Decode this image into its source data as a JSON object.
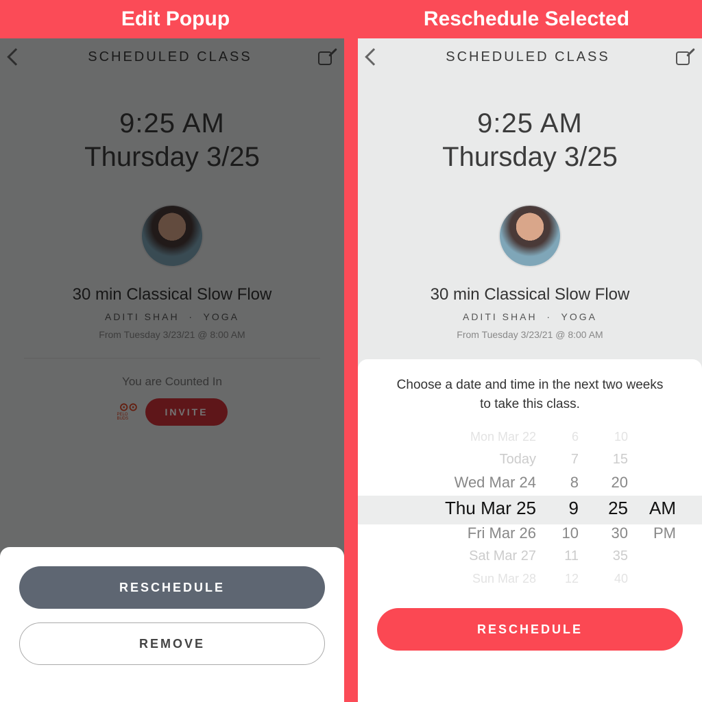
{
  "headers": {
    "left": "Edit Popup",
    "right": "Reschedule Selected"
  },
  "nav": {
    "title": "SCHEDULED CLASS"
  },
  "class": {
    "time": "9:25 AM",
    "date": "Thursday 3/25",
    "title": "30 min Classical Slow Flow",
    "instructor": "ADITI SHAH",
    "sep": "·",
    "category": "YOGA",
    "from": "From Tuesday 3/23/21 @ 8:00 AM",
    "counted": "You are Counted In",
    "buds_label": "PELO BUDS",
    "invite": "INVITE"
  },
  "popup_edit": {
    "reschedule": "RESCHEDULE",
    "remove": "REMOVE"
  },
  "popup_resched": {
    "instruction": "Choose a date and time in the next two weeks to take this class.",
    "button": "RESCHEDULE",
    "picker": {
      "dates": [
        "Mon Mar 22",
        "Today",
        "Wed Mar 24",
        "Thu Mar 25",
        "Fri Mar 26",
        "Sat Mar 27",
        "Sun Mar 28"
      ],
      "hours": [
        "6",
        "7",
        "8",
        "9",
        "10",
        "11",
        "12"
      ],
      "minutes": [
        "10",
        "15",
        "20",
        "25",
        "30",
        "35",
        "40"
      ],
      "ampm": [
        "",
        "",
        "",
        "AM",
        "PM",
        "",
        ""
      ]
    }
  }
}
